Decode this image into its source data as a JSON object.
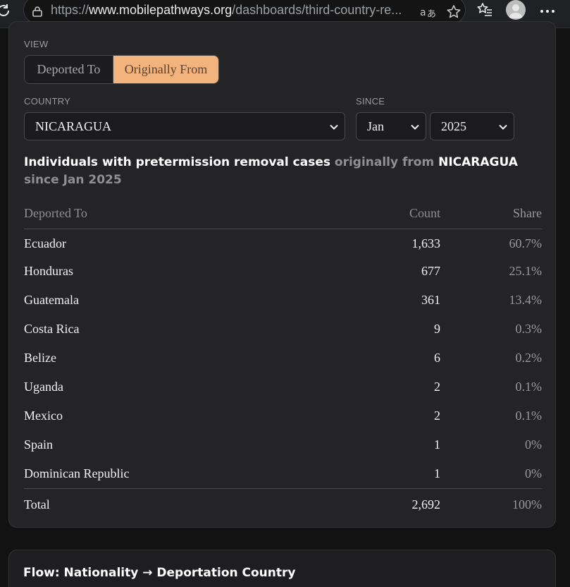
{
  "browser": {
    "url_prefix": "https://",
    "url_host": "www.mobilepathways.org",
    "url_path": "/dashboards/third-country-re..."
  },
  "filters": {
    "view_label": "VIEW",
    "view_options": [
      "Deported To",
      "Originally From"
    ],
    "view_selected": "Originally From",
    "country_label": "COUNTRY",
    "country_value": "NICARAGUA",
    "since_label": "SINCE",
    "month_value": "Jan",
    "year_value": "2025"
  },
  "heading": {
    "part1": "Individuals with pretermission removal cases ",
    "part2": "originally from ",
    "country": "NICARAGUA",
    "part3": " since Jan 2025"
  },
  "table": {
    "columns": [
      "Deported To",
      "Count",
      "Share"
    ],
    "rows": [
      {
        "country": "Ecuador",
        "count": "1,633",
        "share": "60.7%"
      },
      {
        "country": "Honduras",
        "count": "677",
        "share": "25.1%"
      },
      {
        "country": "Guatemala",
        "count": "361",
        "share": "13.4%"
      },
      {
        "country": "Costa Rica",
        "count": "9",
        "share": "0.3%"
      },
      {
        "country": "Belize",
        "count": "6",
        "share": "0.2%"
      },
      {
        "country": "Uganda",
        "count": "2",
        "share": "0.1%"
      },
      {
        "country": "Mexico",
        "count": "2",
        "share": "0.1%"
      },
      {
        "country": "Spain",
        "count": "1",
        "share": "0%"
      },
      {
        "country": "Dominican Republic",
        "count": "1",
        "share": "0%"
      }
    ],
    "total": {
      "label": "Total",
      "count": "2,692",
      "share": "100%"
    }
  },
  "flow_card": {
    "title": "Flow: Nationality → Deportation Country"
  },
  "colors": {
    "accent": "#f3b37c",
    "card_bg": "#242426",
    "page_bg": "#121212"
  }
}
